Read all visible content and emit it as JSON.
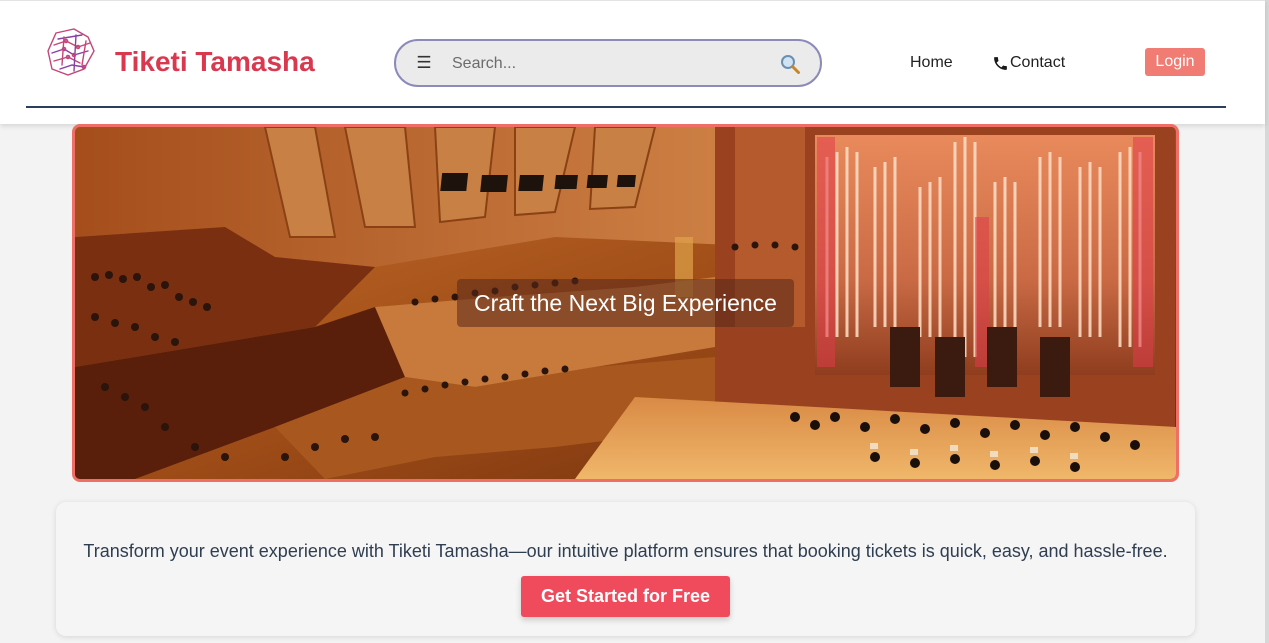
{
  "brand": {
    "name": "Tiketi Tamasha",
    "logo_icon": "circuit-ticket-icon",
    "color": "#d9384f"
  },
  "search": {
    "placeholder": "Search...",
    "value": "",
    "menu_icon": "menu-icon",
    "menu_glyph": "☰",
    "search_icon": "magnifier-icon"
  },
  "nav": {
    "home_label": "Home",
    "contact_label": "Contact",
    "contact_icon": "phone-icon",
    "login_label": "Login"
  },
  "hero": {
    "caption": "Craft the Next Big Experience",
    "image": "concert-hall-with-pipe-organ-and-orchestra",
    "border_color": "#ef6f66"
  },
  "intro": {
    "text": "Transform your event experience with Tiketi Tamasha—our intuitive platform ensures that booking tickets is quick, easy, and hassle-free.",
    "cta_label": "Get Started for Free",
    "cta_color": "#f04a5d"
  },
  "colors": {
    "accent": "#d9384f",
    "login": "#f07c73",
    "header_rule": "#2c3e5e",
    "search_border": "#8b8ab8"
  }
}
